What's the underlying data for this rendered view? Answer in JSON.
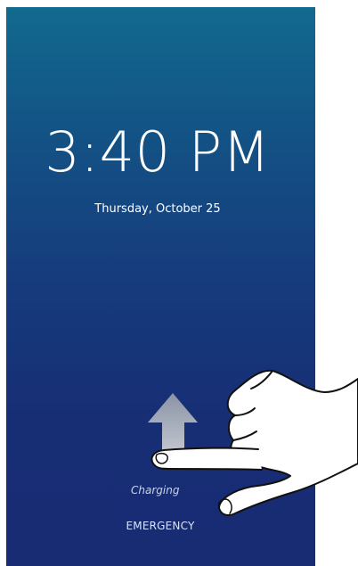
{
  "lockscreen": {
    "time": "3:40 PM",
    "date": "Thursday, October 25",
    "status": "Charging",
    "emergency_label": "EMERGENCY"
  },
  "gesture": {
    "arrow_icon": "up-arrow-icon",
    "hand_icon": "pointing-hand-icon",
    "direction": "swipe-up"
  },
  "colors": {
    "gradient_top": "#126a8f",
    "gradient_bottom": "#172c73",
    "text": "#ffffff"
  }
}
